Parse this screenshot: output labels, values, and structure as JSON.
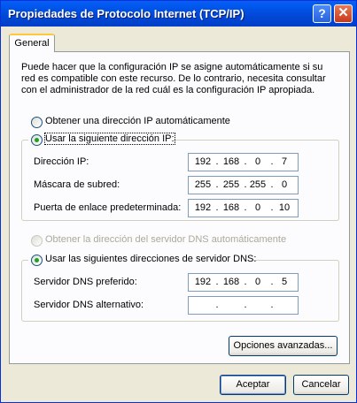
{
  "window": {
    "title": "Propiedades de Protocolo Internet (TCP/IP)",
    "help_glyph": "?",
    "close_glyph": "✕"
  },
  "tabs": [
    {
      "label": "General"
    }
  ],
  "description": "Puede hacer que la configuración IP se asigne automáticamente si su red es compatible con este recurso. De lo contrario, necesita consultar con el administrador de la red cuál es la configuración IP apropiada.",
  "ip_mode": {
    "auto_label": "Obtener una dirección IP automáticamente",
    "manual_label": "Usar la siguiente dirección IP:",
    "selected": "manual"
  },
  "ip_fields": [
    {
      "label": "Dirección IP:",
      "octets": [
        "192",
        "168",
        "0",
        "7"
      ]
    },
    {
      "label": "Máscara de subred:",
      "octets": [
        "255",
        "255",
        "255",
        "0"
      ]
    },
    {
      "label": "Puerta de enlace predeterminada:",
      "octets": [
        "192",
        "168",
        "0",
        "10"
      ]
    }
  ],
  "dns_mode": {
    "auto_label": "Obtener la dirección del servidor DNS automáticamente",
    "manual_label": "Usar las siguientes direcciones de servidor DNS:",
    "selected": "manual",
    "auto_enabled": false
  },
  "dns_fields": [
    {
      "label": "Servidor DNS preferido:",
      "octets": [
        "192",
        "168",
        "0",
        "5"
      ]
    },
    {
      "label": "Servidor DNS alternativo:",
      "octets": [
        "",
        "",
        "",
        ""
      ]
    }
  ],
  "octet_separator": ".",
  "buttons": {
    "advanced": "Opciones avanzadas...",
    "ok": "Aceptar",
    "cancel": "Cancelar"
  },
  "colors": {
    "title_bar": "#0054E3",
    "face": "#ECE9D8",
    "panel": "#FCFCFE",
    "tab_accent": "#FFC83C",
    "radio_dot": "#21A121",
    "close_button": "#D54C2A"
  }
}
